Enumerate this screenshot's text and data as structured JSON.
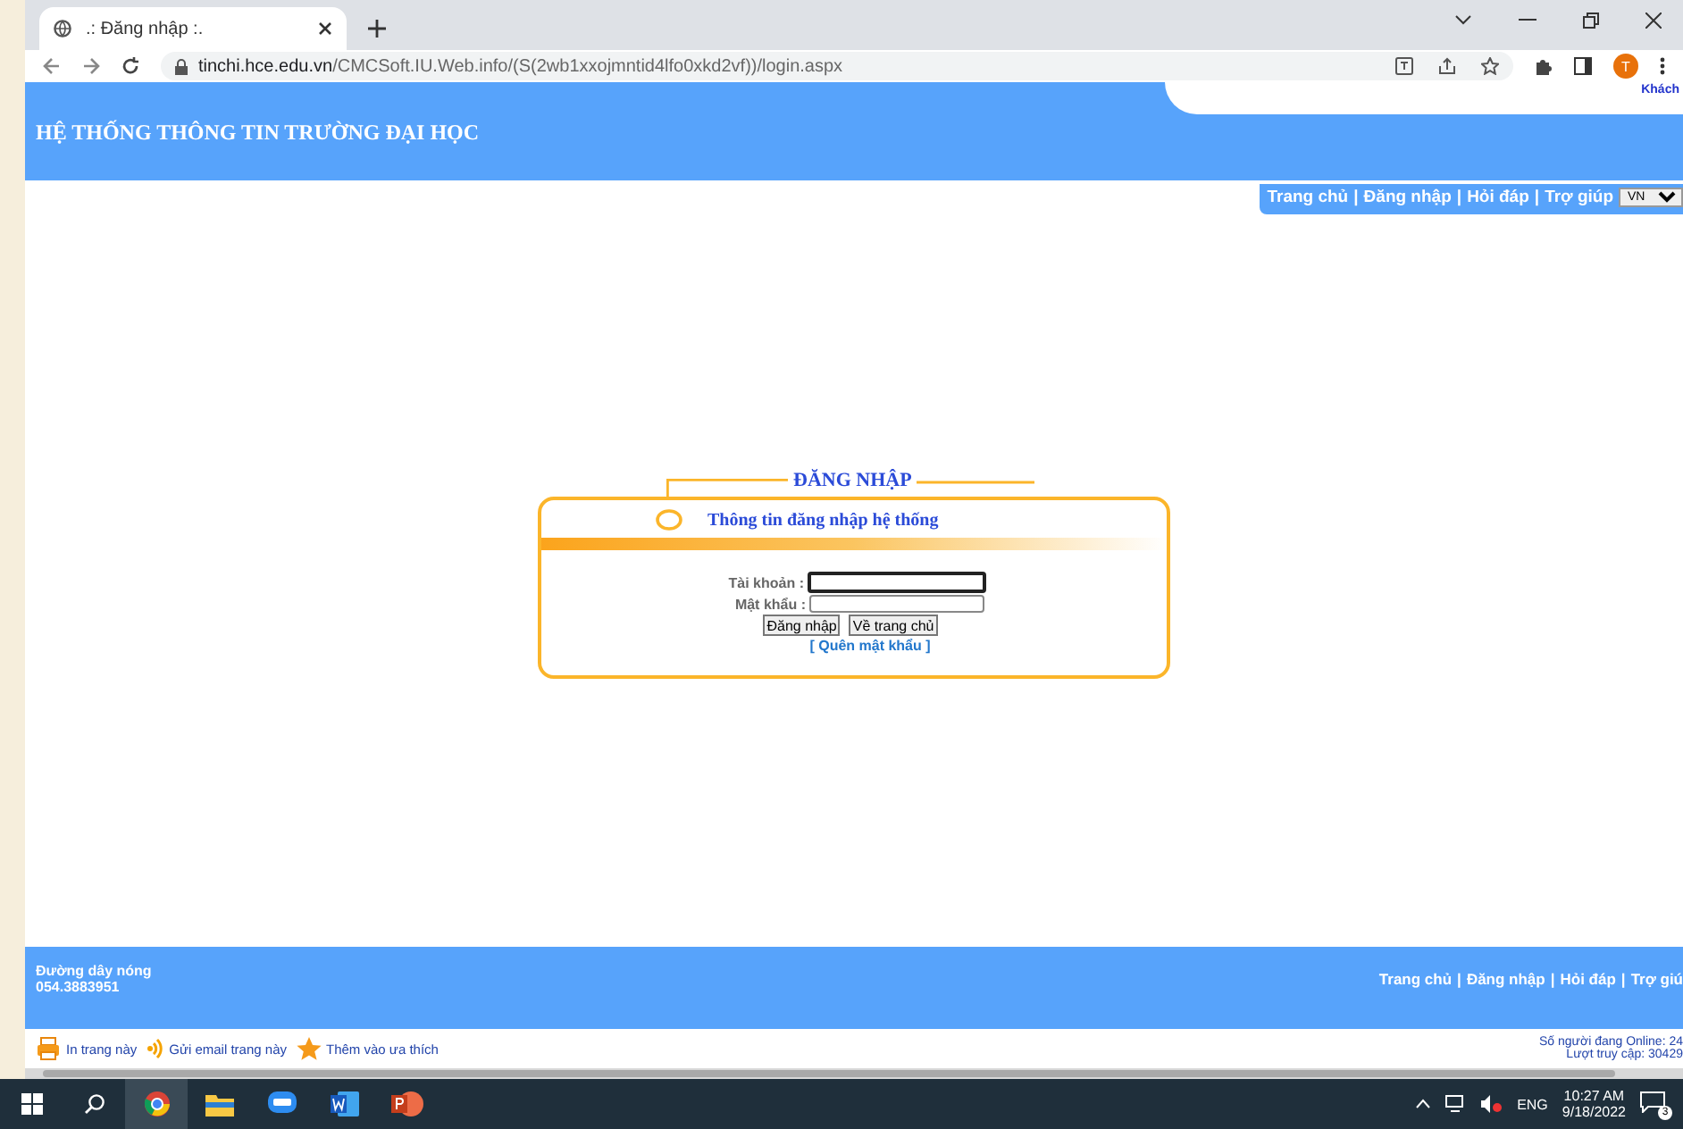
{
  "browser": {
    "tab": {
      "title": ".: Đăng nhập :."
    },
    "address": {
      "host": "tinchi.hce.edu.vn",
      "path": "/CMCSoft.IU.Web.info/(S(2wb1xxojmntid4lfo0xkd2vf))/login.aspx"
    },
    "profile_initial": "T"
  },
  "header": {
    "title": "HỆ THỐNG THÔNG TIN TRƯỜNG ĐẠI HỌC",
    "user": "Khách"
  },
  "nav": {
    "links": [
      "Trang chủ",
      "Đăng nhập",
      "Hỏi đáp",
      "Trợ giúp"
    ],
    "separator": "|",
    "language": "VN"
  },
  "login": {
    "title": "ĐĂNG NHẬP",
    "subtitle": "Thông tin đăng nhập hệ thống",
    "fields": [
      {
        "label": "Tài khoản :",
        "focused": true
      },
      {
        "label": "Mật khẩu :",
        "focused": false
      }
    ],
    "buttons": [
      "Đăng nhập",
      "Về trang chủ"
    ],
    "forgot": "[ Quên mật khẩu ]"
  },
  "footer": {
    "hotline_label": "Đường dây nóng",
    "hotline": "054.3883951",
    "links": [
      "Trang chủ",
      "Đăng nhập",
      "Hỏi đáp",
      "Trợ giú"
    ],
    "separator": "|"
  },
  "bottom_bar": {
    "actions": [
      {
        "kind": "print",
        "label": "In trang này"
      },
      {
        "kind": "email",
        "label": "Gửi email trang này"
      },
      {
        "kind": "favorite",
        "label": "Thêm vào ưa thích"
      }
    ],
    "online": "Số người đang Online: 24",
    "visits": "Lượt truy cập: 30429"
  },
  "taskbar": {
    "language": "ENG",
    "time": "10:27 AM",
    "date": "9/18/2022",
    "notifications": "3"
  }
}
